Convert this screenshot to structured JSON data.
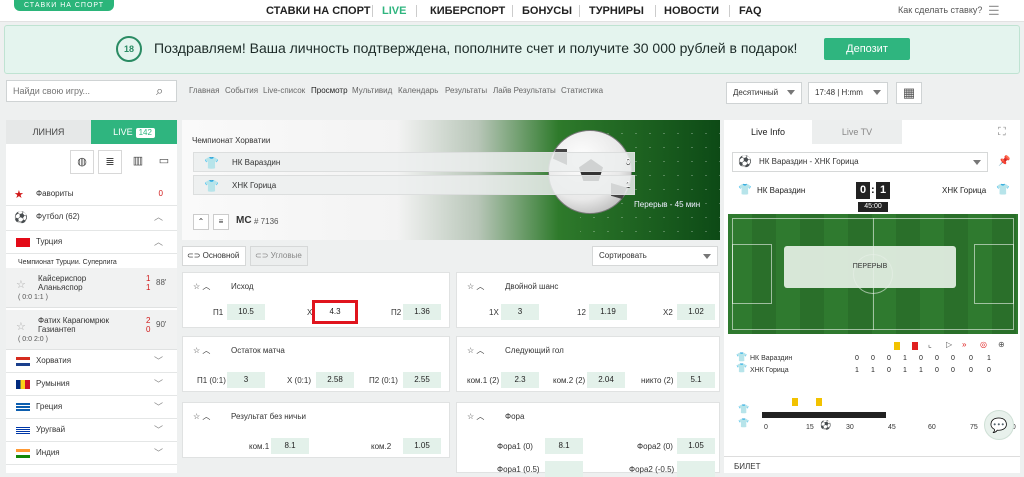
{
  "logo": "СТАВКИ НА СПОРТ",
  "nav": [
    "СТАВКИ НА СПОРТ",
    "LIVE",
    "КИБЕРСПОРТ",
    "БОНУСЫ",
    "ТУРНИРЫ",
    "НОВОСТИ",
    "FAQ"
  ],
  "nav_active": "LIVE",
  "help": "Как сделать ставку?",
  "banner": {
    "age": "18",
    "text": "Поздравляем! Ваша личность подтверждена, пополните счет и получите 30 000 рублей в подарок!",
    "button": "Депозит"
  },
  "search": {
    "placeholder": "Найди свою игру..."
  },
  "crumbs": [
    "Главная",
    "События",
    "Live-список",
    "Просмотр",
    "Мультивид",
    "Календарь",
    "Результаты",
    "Лайв Результаты",
    "Статистика"
  ],
  "odds_format": "Десятичный",
  "time_format": "17:48 | H:mm",
  "sidebar": {
    "tab_line": "ЛИНИЯ",
    "tab_live": "LIVE",
    "live_count": "142",
    "favorites": "Фавориты",
    "favorites_count": "0",
    "football": "Футбол (62)",
    "turkey": "Турция",
    "league": "Чемпионат Турции. Суперлига",
    "m1": {
      "t1": "Кайсериспор",
      "t2": "Аланьяспор",
      "s1": "1",
      "s2": "1",
      "score": "( 0:0  1:1 )",
      "min": "88'"
    },
    "m2": {
      "t1": "Фатих Карагюмрюк",
      "t2": "Газиантеп",
      "s1": "2",
      "s2": "0",
      "score": "( 0:0  2:0 )",
      "min": "90'"
    },
    "countries": [
      "Хорватия",
      "Румыния",
      "Греция",
      "Уругвай",
      "Индия"
    ]
  },
  "hero": {
    "league": "Чемпионат Хорватии",
    "team1": "НК Вараздин",
    "team2": "ХНК Горица",
    "s1a": "0",
    "s1b": "0",
    "s2a": "1",
    "s2b": "1",
    "mc": "MC",
    "id": "# 7136",
    "half": "Перерыв - 45 мин"
  },
  "tabs": {
    "main": "Основной",
    "corners": "Угловые",
    "sort": "Сортировать"
  },
  "markets": {
    "outcome": {
      "title": "Исход",
      "p1": "П1",
      "v1": "10.5",
      "x": "X",
      "vx": "4.3",
      "p2": "П2",
      "v2": "1.36"
    },
    "double": {
      "title": "Двойной шанс",
      "l1": "1X",
      "v1": "3",
      "l2": "12",
      "v2": "1.19",
      "l3": "X2",
      "v3": "1.02"
    },
    "rest": {
      "title": "Остаток матча",
      "l1": "П1 (0:1)",
      "v1": "3",
      "l2": "X (0:1)",
      "v2": "2.58",
      "l3": "П2 (0:1)",
      "v3": "2.55"
    },
    "nextgoal": {
      "title": "Следующий гол",
      "l1": "ком.1 (2)",
      "v1": "2.3",
      "l2": "ком.2 (2)",
      "v2": "2.04",
      "l3": "никто (2)",
      "v3": "5.1"
    },
    "nodraw": {
      "title": "Результат без ничьи",
      "l1": "ком.1",
      "v1": "8.1",
      "l2": "ком.2",
      "v2": "1.05"
    },
    "fora": {
      "title": "Фора",
      "l1": "Фора1 (0)",
      "v1": "8.1",
      "l2": "Фора2 (0)",
      "v2": "1.05",
      "l3": "Фора1 (0.5)",
      "l4": "Фора2 (-0.5)"
    }
  },
  "right": {
    "tab_info": "Live Info",
    "tab_tv": "Live TV",
    "match": "НК Вараздин - ХНК Горица",
    "home": "НК Вараздин",
    "away": "ХНК Горица",
    "sh": "0",
    "sa": "1",
    "time": "45:00",
    "field_status": "ПЕРЕРЫВ",
    "stats_home": [
      "0",
      "0",
      "0",
      "1",
      "0",
      "0",
      "0",
      "0",
      "1"
    ],
    "stats_away": [
      "1",
      "1",
      "0",
      "1",
      "1",
      "0",
      "0",
      "0",
      "0"
    ],
    "timeline": [
      "0",
      "15",
      "30",
      "45",
      "60",
      "75",
      "90"
    ],
    "bet": "БИЛЕТ"
  }
}
